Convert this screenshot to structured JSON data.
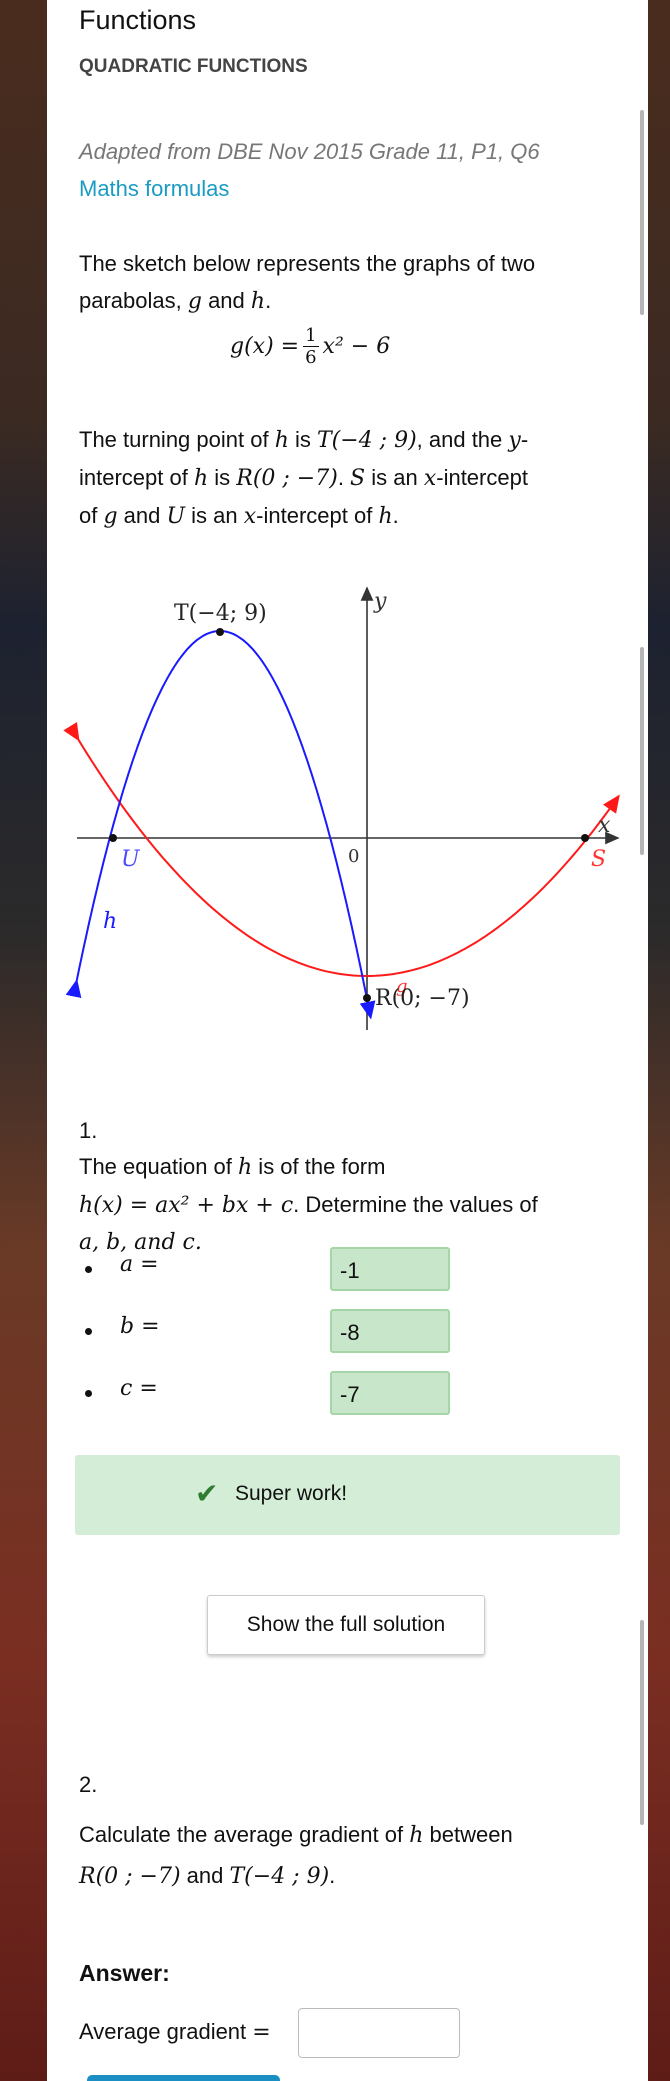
{
  "header": {
    "title": "Functions",
    "subtitle": "QUADRATIC FUNCTIONS"
  },
  "source": "Adapted from DBE Nov 2015 Grade 11, P1, Q6",
  "link": "Maths formulas",
  "intro": {
    "line1": "The sketch below represents the graphs of two",
    "line2_pre": "parabolas, ",
    "g": "g",
    "and": " and ",
    "h": "h",
    "dot": "."
  },
  "equation": {
    "lhs": "g(x) = ",
    "num": "1",
    "den": "6",
    "rhs": "x² − 6"
  },
  "desc": {
    "l1a": "The turning point of ",
    "h": "h",
    "l1b": " is ",
    "T": "T(−4 ; 9)",
    "l1c": ", and the ",
    "y": "y",
    "l1d": "-",
    "l2a": "intercept of ",
    "l2b": " is ",
    "R": "R(0 ; −7)",
    "l2c": ". ",
    "S": "S",
    "l2d": " is an ",
    "x": "x",
    "l2e": "-intercept",
    "l3a": "of ",
    "g": "g",
    "l3b": " and ",
    "U": "U",
    "l3c": " is an ",
    "l3d": "-intercept of ",
    "l3e": "."
  },
  "graph": {
    "labels": {
      "T": "T(−4; 9)",
      "y": "y",
      "x": "x",
      "U": "U",
      "S": "S",
      "h": "h",
      "g": "g",
      "origin": "0",
      "R": "R(0; −7)"
    },
    "h": {
      "a": -1,
      "b": -8,
      "c": -7
    },
    "g": {
      "a": 0.1666667,
      "b": 0,
      "c": -6
    },
    "colors": {
      "h": "#1a1aff",
      "g": "#ff1a1a",
      "axis": "#333333"
    }
  },
  "q1": {
    "number": "1.",
    "l1": "The equation of ",
    "h": "h",
    "l1b": " is of the form",
    "l2": "h(x) = ax² + bx + c",
    "l2b": ". Determine the values of",
    "l3": "a, b, and c.",
    "answers": [
      {
        "var": "a =",
        "value": "-1"
      },
      {
        "var": "b =",
        "value": "-8"
      },
      {
        "var": "c =",
        "value": "-7"
      }
    ],
    "feedback": "Super work!",
    "solution_button": "Show the full solution"
  },
  "q2": {
    "number": "2.",
    "l1": "Calculate the average gradient of ",
    "h": "h",
    "l1b": " between",
    "R": "R(0 ; −7)",
    "and": " and ",
    "T": "T(−4 ; 9)",
    "dot": ".",
    "answer_label": "Answer:",
    "field_label": "Average gradient ",
    "eq": "=",
    "field_value": ""
  },
  "colors": {
    "link": "#1a9bc4",
    "success_bg": "#d4edd6",
    "check": "#2e7d32"
  }
}
